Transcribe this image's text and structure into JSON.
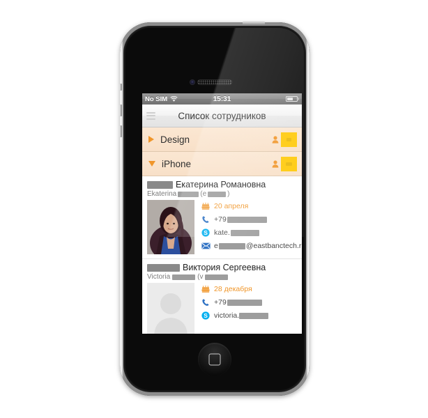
{
  "device": {
    "name": "iPhone 4",
    "home_button_glyph": "rounded-square"
  },
  "status_bar": {
    "carrier": "No SIM",
    "wifi_icon": "wifi-icon",
    "time": "15:31",
    "battery_icon": "battery-icon",
    "battery_level_pct": 62
  },
  "nav_bar": {
    "menu_icon": "list-menu-icon",
    "title": "Список сотрудников"
  },
  "groups": [
    {
      "name": "Design",
      "expanded": false,
      "disclosure_icon": "triangle-right-icon",
      "member_icon": "person-icon",
      "count": "",
      "count_redacted": true,
      "contacts": []
    },
    {
      "name": "iPhone",
      "expanded": true,
      "disclosure_icon": "triangle-down-icon",
      "member_icon": "person-icon",
      "count": "",
      "count_redacted": true,
      "contacts": [
        {
          "name_visible": "Екатерина Романовна",
          "name_redacted_prefix": true,
          "latin_first": "Ekaterina",
          "latin_paren_open": "(e",
          "latin_paren_close": ")",
          "photo": "woman-photo",
          "rows": [
            {
              "icon": "birthday-cake-icon",
              "text": "20 апреля",
              "type": "birthday",
              "redacted": false
            },
            {
              "icon": "phone-icon",
              "text": "+79",
              "type": "phone",
              "redacted": true
            },
            {
              "icon": "skype-icon",
              "text": "kate.",
              "type": "skype",
              "redacted": true
            },
            {
              "icon": "email-icon",
              "text": "e",
              "suffix": "@eastbanctech.ru",
              "type": "email",
              "redacted": true
            }
          ]
        },
        {
          "name_visible": "Виктория Сергеевна",
          "name_redacted_prefix": true,
          "latin_first": "Victoria",
          "latin_paren_open": "(v",
          "latin_paren_close": "",
          "photo": "placeholder-avatar",
          "rows": [
            {
              "icon": "birthday-cake-icon",
              "text": "28 декабря",
              "type": "birthday",
              "redacted": false
            },
            {
              "icon": "phone-icon",
              "text": "+79",
              "type": "phone",
              "redacted": true
            },
            {
              "icon": "skype-icon",
              "text": "victoria.",
              "type": "skype",
              "redacted": true
            }
          ]
        }
      ]
    }
  ],
  "colors": {
    "accent_orange": "#f0962a",
    "badge_yellow": "#ffc907",
    "group_row_bg": "#fae2ca",
    "skype_blue": "#00aff0",
    "phone_blue": "#2f72c4",
    "redaction_gray": "#9d9d9d",
    "page_bg": "#ffffff"
  }
}
